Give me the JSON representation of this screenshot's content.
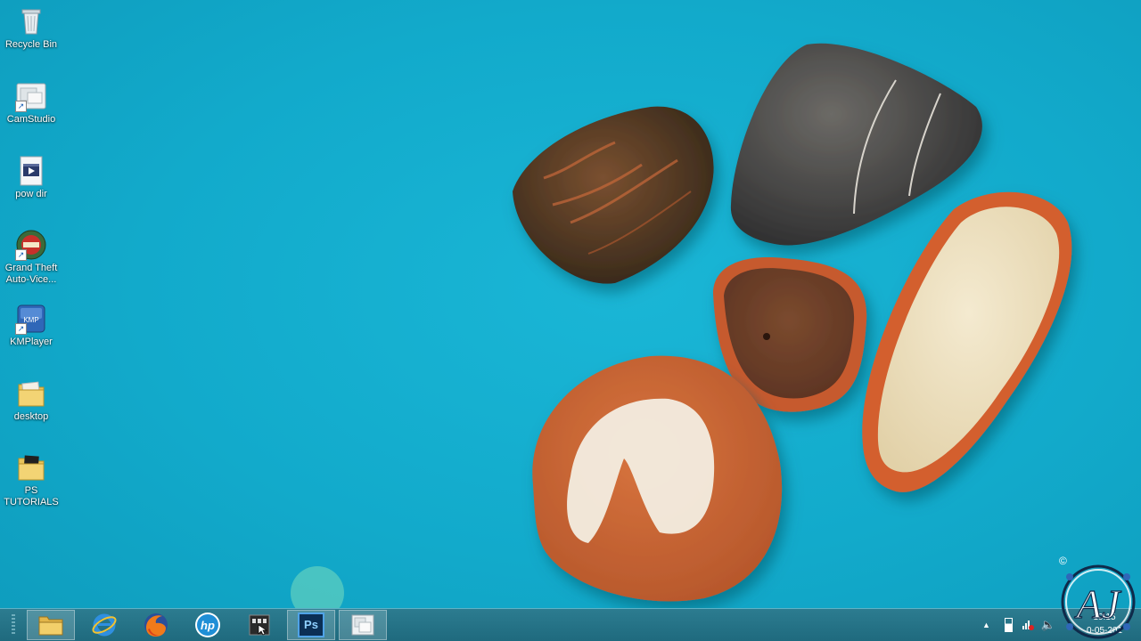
{
  "desktop_icons": [
    {
      "label": "Recycle Bin",
      "icon": "recycle-bin-icon"
    },
    {
      "label": "CamStudio",
      "icon": "camstudio-icon"
    },
    {
      "label": "pow dir",
      "icon": "video-file-icon"
    },
    {
      "label": "Grand Theft Auto-Vice...",
      "icon": "gta-vice-city-icon"
    },
    {
      "label": "KMPlayer",
      "icon": "kmplayer-icon"
    },
    {
      "label": "desktop",
      "icon": "folder-icon"
    },
    {
      "label": "PS TUTORIALS",
      "icon": "folder-icon"
    }
  ],
  "taskbar": {
    "buttons": [
      {
        "name": "file-explorer",
        "icon": "folder-icon",
        "active": true
      },
      {
        "name": "internet-explorer",
        "icon": "ie-icon",
        "active": false
      },
      {
        "name": "firefox",
        "icon": "firefox-icon",
        "active": false
      },
      {
        "name": "hp",
        "icon": "hp-icon",
        "active": false
      },
      {
        "name": "app-manager",
        "icon": "app-icon",
        "active": false
      },
      {
        "name": "photoshop",
        "icon": "photoshop-icon",
        "active": true,
        "text": "Ps"
      },
      {
        "name": "camstudio",
        "icon": "camstudio-icon",
        "active": true
      }
    ],
    "hp_text": "hp",
    "clock": {
      "time": "19:15",
      "date": "0-05-201"
    }
  },
  "watermark": {
    "text": "AJ",
    "copyright": "©"
  },
  "colors": {
    "wallpaper": "#12aacb",
    "taskbar": "#2c7c90"
  }
}
